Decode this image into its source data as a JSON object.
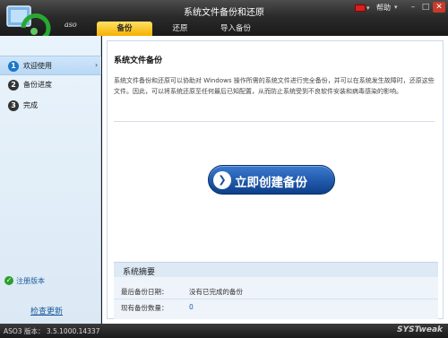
{
  "window": {
    "title": "系统文件备份和还原",
    "brand": "aso",
    "help_label": "帮助",
    "minimize_glyph": "–",
    "maximize_glyph": "□",
    "close_glyph": "✕"
  },
  "tabs": [
    "备份",
    "还原",
    "导入备份"
  ],
  "sidebar": {
    "steps": [
      {
        "num": "1",
        "label": "欢迎使用"
      },
      {
        "num": "2",
        "label": "备份进度"
      },
      {
        "num": "3",
        "label": "完成"
      }
    ],
    "registered_label": "注册版本",
    "check_update_label": "检查更新"
  },
  "main": {
    "section_title": "系统文件备份",
    "description": "系统文件备份和还原可以协助对 Windows 操作所需的系统文件进行完全备份，并可以在系统发生故障时，还原这些文件。因此，可以将系统还原至任何最后已知配置，从而防止系统受到不良软件安装和病毒感染的影响。",
    "create_backup_label": "立即创建备份",
    "summary": {
      "title": "系统摘要",
      "rows": [
        {
          "key": "最后备份日期：",
          "value": "没有已完成的备份"
        },
        {
          "key": "现有备份数量：",
          "value": "0"
        }
      ]
    }
  },
  "status": {
    "version": "ASO3 版本： 3.5.1000.14337",
    "vendor": "SYSTweak"
  },
  "colors": {
    "accent_tab": "#f4b000",
    "button_blue": "#0d3f8a",
    "step_active": "#1d77c9"
  }
}
